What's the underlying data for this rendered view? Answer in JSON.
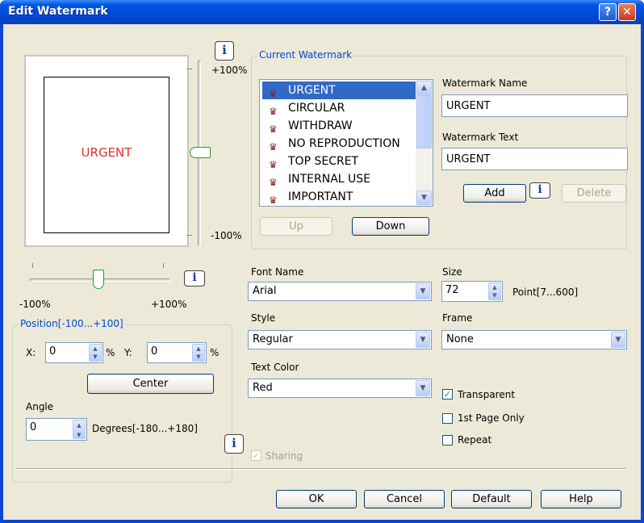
{
  "window": {
    "title": "Edit Watermark",
    "help_glyph": "?",
    "close_glyph": "✕"
  },
  "preview": {
    "text": "URGENT"
  },
  "vertical_slider": {
    "top_label": "+100%",
    "bottom_label": "-100%",
    "level": 0
  },
  "horizontal_slider": {
    "left_label": "-100%",
    "right_label": "+100%",
    "level": 0
  },
  "info_glyph": "i",
  "current_watermark": {
    "legend": "Current Watermark",
    "items": [
      "URGENT",
      "CIRCULAR",
      "WITHDRAW",
      "NO REPRODUCTION",
      "TOP SECRET",
      "INTERNAL USE",
      "IMPORTANT"
    ],
    "selected_index": 0,
    "up_label": "Up",
    "down_label": "Down",
    "name_label": "Watermark Name",
    "name_value": "URGENT",
    "text_label": "Watermark Text",
    "text_value": "URGENT",
    "add_label": "Add",
    "delete_label": "Delete"
  },
  "position": {
    "legend": "Position[-100...+100]",
    "x_label": "X:",
    "x_value": "0",
    "x_unit": "%",
    "y_label": "Y:",
    "y_value": "0",
    "y_unit": "%",
    "center_label": "Center",
    "angle_label": "Angle",
    "angle_value": "0",
    "angle_unit": "Degrees[-180...+180]"
  },
  "font": {
    "label": "Font Name",
    "value": "Arial"
  },
  "size": {
    "label": "Size",
    "value": "72",
    "unit": "Point[7...600]"
  },
  "style": {
    "label": "Style",
    "value": "Regular"
  },
  "frame": {
    "label": "Frame",
    "value": "None"
  },
  "text_color": {
    "label": "Text Color",
    "value": "Red"
  },
  "options": {
    "transparent": {
      "label": "Transparent",
      "checked": true
    },
    "first_page": {
      "label": "1st Page Only",
      "checked": false
    },
    "repeat": {
      "label": "Repeat",
      "checked": false
    },
    "sharing": {
      "label": "Sharing",
      "checked": true,
      "disabled": true
    }
  },
  "buttons": {
    "ok": "OK",
    "cancel": "Cancel",
    "default": "Default",
    "help": "Help"
  },
  "colors": {
    "title_bar": "#0055E5",
    "dialog": "#ECE9D8",
    "selection": "#316AC5",
    "watermark_text": "#E03030",
    "group_label": "#0046D5"
  }
}
